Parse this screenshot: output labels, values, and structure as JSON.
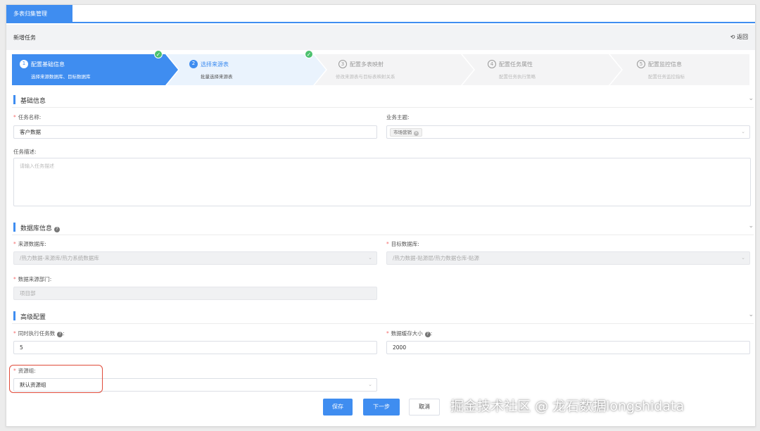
{
  "tab": {
    "label": "多表归集管理"
  },
  "header": {
    "title": "新增任务",
    "back_label": "返回"
  },
  "steps": [
    {
      "num": "1",
      "title": "配置基础信息",
      "desc": "选择来源数据库、目标数据库",
      "state": "done"
    },
    {
      "num": "2",
      "title": "选择来源表",
      "desc": "批量选择来源表",
      "state": "current"
    },
    {
      "num": "3",
      "title": "配置多表映射",
      "desc": "修改来源表与目标表映射关系",
      "state": "pending"
    },
    {
      "num": "4",
      "title": "配置任务属性",
      "desc": "配置任务执行策略",
      "state": "pending"
    },
    {
      "num": "5",
      "title": "配置监控信息",
      "desc": "配置任务监控指标",
      "state": "pending"
    }
  ],
  "sections": {
    "basic": "基础信息",
    "database": "数据库信息",
    "advanced": "高级配置"
  },
  "form": {
    "task_name": {
      "label": "任务名称:",
      "value": "客户数据"
    },
    "business_topic": {
      "label": "业务主题:",
      "tag": "市场营销"
    },
    "task_desc": {
      "label": "任务描述:",
      "placeholder": "请输入任务描述"
    },
    "source_db": {
      "label": "来源数据库:",
      "value": "/热力数据-来源库/热力系统数据库"
    },
    "target_db": {
      "label": "目标数据库:",
      "value": "/热力数据-贴源层/热力数据仓库-贴源"
    },
    "source_dept": {
      "label": "数据来源部门:",
      "value": "项目部"
    },
    "concurrent": {
      "label": "同时执行任务数",
      "value": "5"
    },
    "cache_size": {
      "label": "数据缓存大小",
      "value": "2000"
    },
    "resource_group": {
      "label": "资源组:",
      "value": "默认资源组"
    }
  },
  "buttons": {
    "save": "保存",
    "next": "下一步",
    "cancel": "取消"
  },
  "watermark": "掘金技术社区 @ 龙石数据longshidata",
  "colors": {
    "primary": "#3f8df0",
    "success": "#4cc16e",
    "required": "#f56c6c",
    "highlight": "#e04b3a"
  }
}
